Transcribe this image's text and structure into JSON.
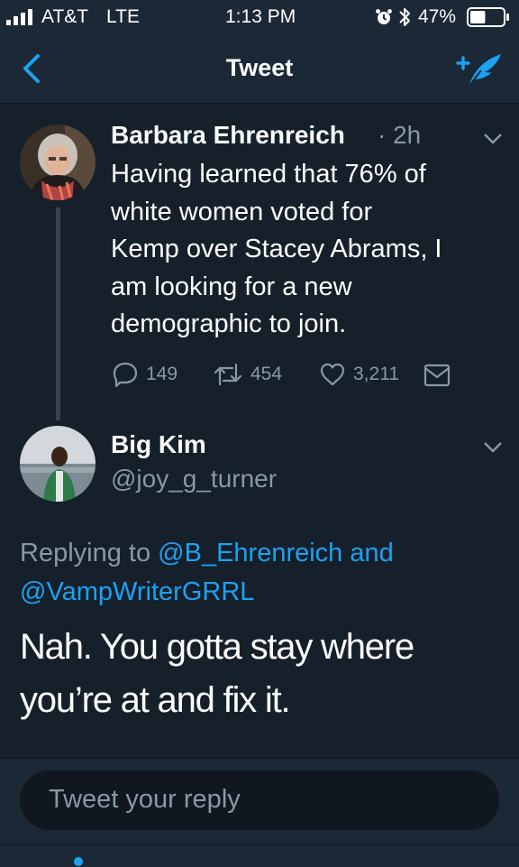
{
  "status_bar": {
    "carrier": "AT&T",
    "network": "LTE",
    "time": "1:13 PM",
    "battery_percent": "47%",
    "battery_level": 0.47
  },
  "nav": {
    "title": "Tweet",
    "back_icon": "chevron-left-icon",
    "compose_icon": "compose-tweet-icon"
  },
  "parent_tweet": {
    "display_name": "Barbara Ehrenreich",
    "timestamp": "· 2h",
    "text_lines": [
      "Having learned that 76% of",
      "white women voted for",
      "Kemp over Stacey Abrams, I",
      "am looking for a new",
      "demographic to join."
    ],
    "replies": "149",
    "retweets": "454",
    "likes": "3,211"
  },
  "reply_tweet": {
    "display_name": "Big Kim",
    "handle": "@joy_g_turner",
    "replying_prefix": "Replying to",
    "mention1": "@B_Ehrenreich",
    "joiner": "and",
    "mention2": "@VampWriterGRRL",
    "text_lines": [
      "Nah. You gotta stay where",
      "you’re at and fix it."
    ]
  },
  "composer": {
    "placeholder": "Tweet your reply"
  },
  "colors": {
    "background": "#15202b",
    "bar": "#1b2836",
    "accent": "#1da1f2",
    "secondary_text": "#8899a6"
  }
}
